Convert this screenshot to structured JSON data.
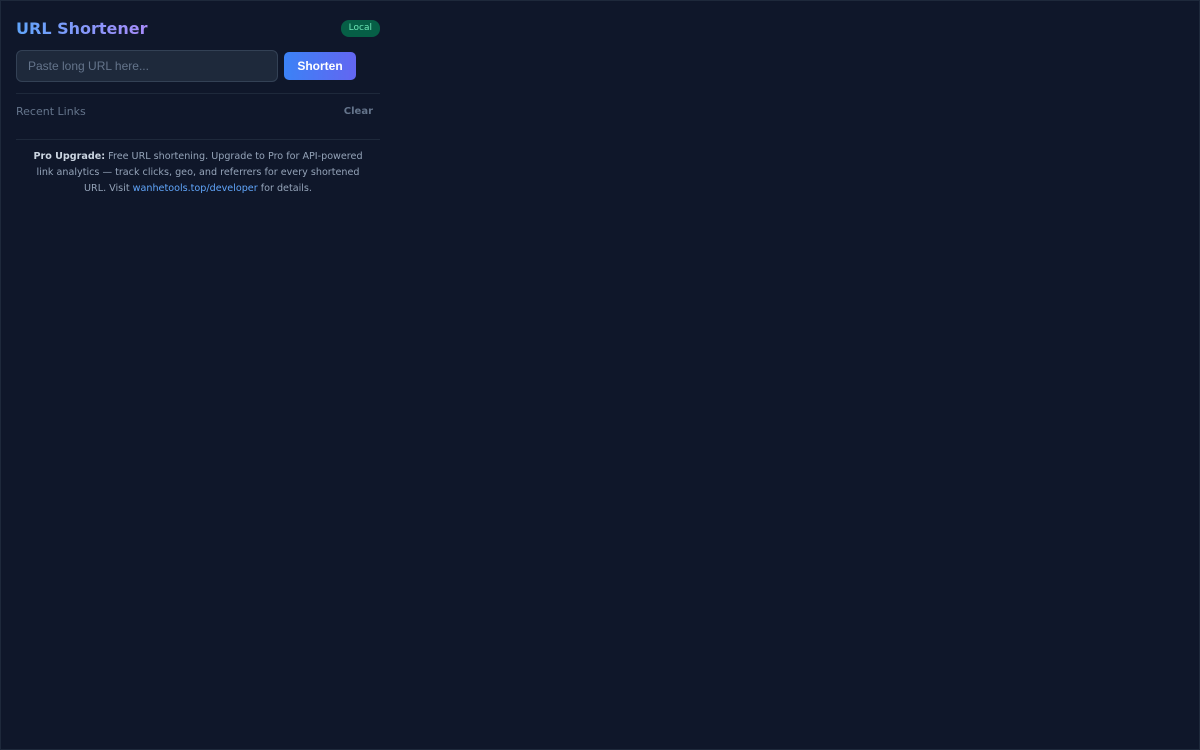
{
  "app": {
    "title": "URL Shortener",
    "badge": "Local"
  },
  "form": {
    "url_placeholder": "Paste long URL here...",
    "url_value": "",
    "shorten_label": "Shorten"
  },
  "recent": {
    "label": "Recent Links",
    "clear_label": "Clear"
  },
  "promo": {
    "lead": "Pro Upgrade:",
    "text_before_link": " Free URL shortening. Upgrade to Pro for API-powered link analytics — track clicks, geo, and referrers for every shortened URL. Visit ",
    "link_text": "wanhetools.top/developer",
    "text_after_link": " for details."
  },
  "colors": {
    "background": "#0f172a",
    "accent_start": "#3b82f6",
    "accent_end": "#6366f1",
    "badge_bg": "#065f46",
    "badge_text": "#6ee7b7",
    "link": "#60a5fa"
  }
}
